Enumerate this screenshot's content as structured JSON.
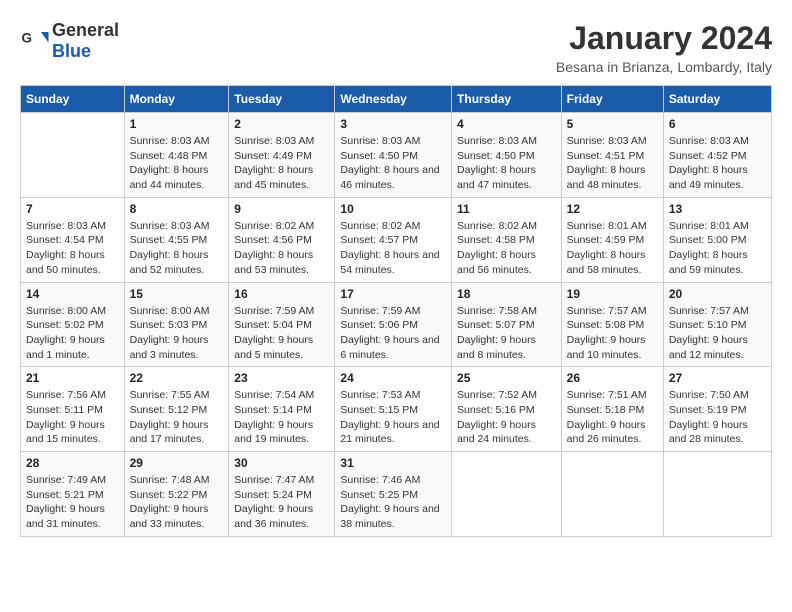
{
  "header": {
    "logo_general": "General",
    "logo_blue": "Blue",
    "title": "January 2024",
    "subtitle": "Besana in Brianza, Lombardy, Italy"
  },
  "days_of_week": [
    "Sunday",
    "Monday",
    "Tuesday",
    "Wednesday",
    "Thursday",
    "Friday",
    "Saturday"
  ],
  "weeks": [
    [
      {
        "day": "",
        "sunrise": "",
        "sunset": "",
        "daylight": ""
      },
      {
        "day": "1",
        "sunrise": "Sunrise: 8:03 AM",
        "sunset": "Sunset: 4:48 PM",
        "daylight": "Daylight: 8 hours and 44 minutes."
      },
      {
        "day": "2",
        "sunrise": "Sunrise: 8:03 AM",
        "sunset": "Sunset: 4:49 PM",
        "daylight": "Daylight: 8 hours and 45 minutes."
      },
      {
        "day": "3",
        "sunrise": "Sunrise: 8:03 AM",
        "sunset": "Sunset: 4:50 PM",
        "daylight": "Daylight: 8 hours and 46 minutes."
      },
      {
        "day": "4",
        "sunrise": "Sunrise: 8:03 AM",
        "sunset": "Sunset: 4:50 PM",
        "daylight": "Daylight: 8 hours and 47 minutes."
      },
      {
        "day": "5",
        "sunrise": "Sunrise: 8:03 AM",
        "sunset": "Sunset: 4:51 PM",
        "daylight": "Daylight: 8 hours and 48 minutes."
      },
      {
        "day": "6",
        "sunrise": "Sunrise: 8:03 AM",
        "sunset": "Sunset: 4:52 PM",
        "daylight": "Daylight: 8 hours and 49 minutes."
      }
    ],
    [
      {
        "day": "7",
        "sunrise": "Sunrise: 8:03 AM",
        "sunset": "Sunset: 4:54 PM",
        "daylight": "Daylight: 8 hours and 50 minutes."
      },
      {
        "day": "8",
        "sunrise": "Sunrise: 8:03 AM",
        "sunset": "Sunset: 4:55 PM",
        "daylight": "Daylight: 8 hours and 52 minutes."
      },
      {
        "day": "9",
        "sunrise": "Sunrise: 8:02 AM",
        "sunset": "Sunset: 4:56 PM",
        "daylight": "Daylight: 8 hours and 53 minutes."
      },
      {
        "day": "10",
        "sunrise": "Sunrise: 8:02 AM",
        "sunset": "Sunset: 4:57 PM",
        "daylight": "Daylight: 8 hours and 54 minutes."
      },
      {
        "day": "11",
        "sunrise": "Sunrise: 8:02 AM",
        "sunset": "Sunset: 4:58 PM",
        "daylight": "Daylight: 8 hours and 56 minutes."
      },
      {
        "day": "12",
        "sunrise": "Sunrise: 8:01 AM",
        "sunset": "Sunset: 4:59 PM",
        "daylight": "Daylight: 8 hours and 58 minutes."
      },
      {
        "day": "13",
        "sunrise": "Sunrise: 8:01 AM",
        "sunset": "Sunset: 5:00 PM",
        "daylight": "Daylight: 8 hours and 59 minutes."
      }
    ],
    [
      {
        "day": "14",
        "sunrise": "Sunrise: 8:00 AM",
        "sunset": "Sunset: 5:02 PM",
        "daylight": "Daylight: 9 hours and 1 minute."
      },
      {
        "day": "15",
        "sunrise": "Sunrise: 8:00 AM",
        "sunset": "Sunset: 5:03 PM",
        "daylight": "Daylight: 9 hours and 3 minutes."
      },
      {
        "day": "16",
        "sunrise": "Sunrise: 7:59 AM",
        "sunset": "Sunset: 5:04 PM",
        "daylight": "Daylight: 9 hours and 5 minutes."
      },
      {
        "day": "17",
        "sunrise": "Sunrise: 7:59 AM",
        "sunset": "Sunset: 5:06 PM",
        "daylight": "Daylight: 9 hours and 6 minutes."
      },
      {
        "day": "18",
        "sunrise": "Sunrise: 7:58 AM",
        "sunset": "Sunset: 5:07 PM",
        "daylight": "Daylight: 9 hours and 8 minutes."
      },
      {
        "day": "19",
        "sunrise": "Sunrise: 7:57 AM",
        "sunset": "Sunset: 5:08 PM",
        "daylight": "Daylight: 9 hours and 10 minutes."
      },
      {
        "day": "20",
        "sunrise": "Sunrise: 7:57 AM",
        "sunset": "Sunset: 5:10 PM",
        "daylight": "Daylight: 9 hours and 12 minutes."
      }
    ],
    [
      {
        "day": "21",
        "sunrise": "Sunrise: 7:56 AM",
        "sunset": "Sunset: 5:11 PM",
        "daylight": "Daylight: 9 hours and 15 minutes."
      },
      {
        "day": "22",
        "sunrise": "Sunrise: 7:55 AM",
        "sunset": "Sunset: 5:12 PM",
        "daylight": "Daylight: 9 hours and 17 minutes."
      },
      {
        "day": "23",
        "sunrise": "Sunrise: 7:54 AM",
        "sunset": "Sunset: 5:14 PM",
        "daylight": "Daylight: 9 hours and 19 minutes."
      },
      {
        "day": "24",
        "sunrise": "Sunrise: 7:53 AM",
        "sunset": "Sunset: 5:15 PM",
        "daylight": "Daylight: 9 hours and 21 minutes."
      },
      {
        "day": "25",
        "sunrise": "Sunrise: 7:52 AM",
        "sunset": "Sunset: 5:16 PM",
        "daylight": "Daylight: 9 hours and 24 minutes."
      },
      {
        "day": "26",
        "sunrise": "Sunrise: 7:51 AM",
        "sunset": "Sunset: 5:18 PM",
        "daylight": "Daylight: 9 hours and 26 minutes."
      },
      {
        "day": "27",
        "sunrise": "Sunrise: 7:50 AM",
        "sunset": "Sunset: 5:19 PM",
        "daylight": "Daylight: 9 hours and 28 minutes."
      }
    ],
    [
      {
        "day": "28",
        "sunrise": "Sunrise: 7:49 AM",
        "sunset": "Sunset: 5:21 PM",
        "daylight": "Daylight: 9 hours and 31 minutes."
      },
      {
        "day": "29",
        "sunrise": "Sunrise: 7:48 AM",
        "sunset": "Sunset: 5:22 PM",
        "daylight": "Daylight: 9 hours and 33 minutes."
      },
      {
        "day": "30",
        "sunrise": "Sunrise: 7:47 AM",
        "sunset": "Sunset: 5:24 PM",
        "daylight": "Daylight: 9 hours and 36 minutes."
      },
      {
        "day": "31",
        "sunrise": "Sunrise: 7:46 AM",
        "sunset": "Sunset: 5:25 PM",
        "daylight": "Daylight: 9 hours and 38 minutes."
      },
      {
        "day": "",
        "sunrise": "",
        "sunset": "",
        "daylight": ""
      },
      {
        "day": "",
        "sunrise": "",
        "sunset": "",
        "daylight": ""
      },
      {
        "day": "",
        "sunrise": "",
        "sunset": "",
        "daylight": ""
      }
    ]
  ]
}
